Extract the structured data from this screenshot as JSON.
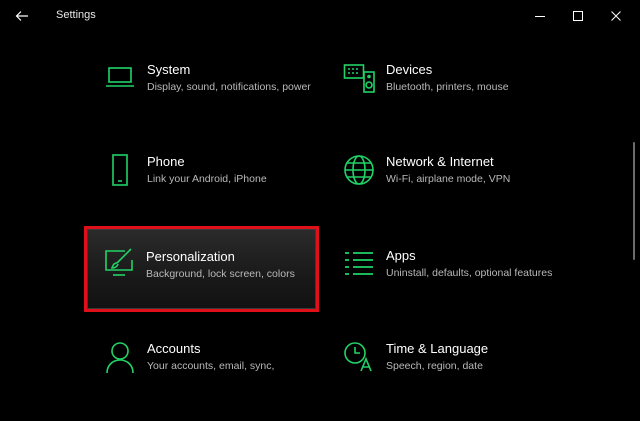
{
  "window": {
    "title": "Settings",
    "back_icon": "back-arrow-icon",
    "controls": [
      "minimize-icon",
      "maximize-icon",
      "close-icon"
    ]
  },
  "accent_color": "#21d367",
  "highlight_color": "#e0101a",
  "tiles": [
    {
      "name": "System",
      "desc": "Display, sound, notifications, power",
      "icon": "laptop-icon"
    },
    {
      "name": "Devices",
      "desc": "Bluetooth, printers, mouse",
      "icon": "keyboard-speaker-icon"
    },
    {
      "name": "Phone",
      "desc": "Link your Android, iPhone",
      "icon": "phone-icon"
    },
    {
      "name": "Network & Internet",
      "desc": "Wi-Fi, airplane mode, VPN",
      "icon": "globe-icon"
    },
    {
      "name": "Personalization",
      "desc": "Background, lock screen, colors",
      "icon": "brush-screen-icon"
    },
    {
      "name": "Apps",
      "desc": "Uninstall, defaults, optional features",
      "icon": "apps-list-icon"
    },
    {
      "name": "Accounts",
      "desc": "Your accounts, email, sync,",
      "icon": "person-icon"
    },
    {
      "name": "Time & Language",
      "desc": "Speech, region, date",
      "icon": "time-language-icon"
    }
  ]
}
